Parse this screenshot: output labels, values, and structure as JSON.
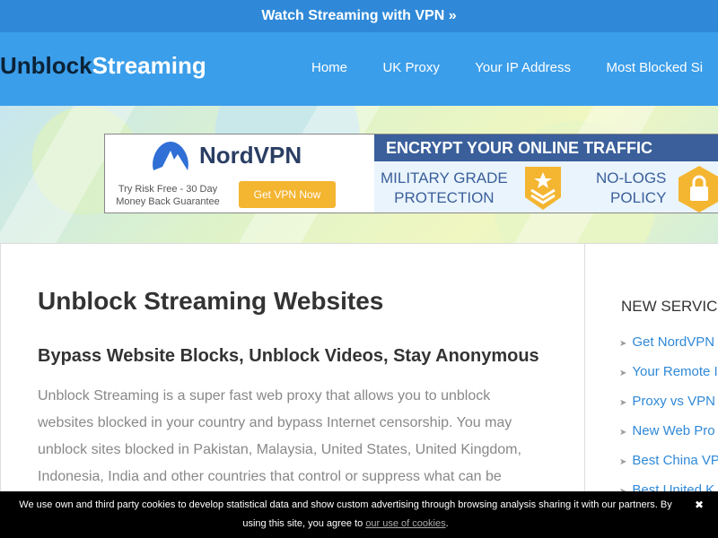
{
  "topbar": {
    "link": "Watch Streaming with VPN »"
  },
  "header": {
    "logo_part1": "Unblock",
    "logo_part2": "Streaming",
    "nav": [
      "Home",
      "UK Proxy",
      "Your IP Address",
      "Most Blocked Si"
    ]
  },
  "banner": {
    "brand": "NordVPN",
    "try_line1": "Try Risk Free - 30 Day",
    "try_line2": "Money Back Guarantee",
    "button": "Get VPN Now",
    "headline": "ENCRYPT YOUR ONLINE TRAFFIC",
    "feature1_line1": "MILITARY GRADE",
    "feature1_line2": "PROTECTION",
    "feature2_line1": "NO-LOGS",
    "feature2_line2": "POLICY"
  },
  "main": {
    "title": "Unblock Streaming Websites",
    "subtitle": "Bypass Website Blocks, Unblock Videos, Stay Anonymous",
    "intro": "Unblock Streaming is a super fast web proxy that allows you to unblock websites blocked in your country and bypass Internet censorship. You may unblock sites blocked in Pakistan, Malaysia, United States, United Kingdom, Indonesia, India and other countries that control or suppress what can be"
  },
  "sidebar": {
    "title": "NEW SERVIC",
    "items": [
      "Get NordVPN",
      "Your Remote I",
      "Proxy vs VPN",
      "New Web Pro",
      "Best China VP",
      "Best United K"
    ]
  },
  "cookie": {
    "text": "We use own and third party cookies to develop statistical data and show custom advertising through browsing analysis sharing it with our partners. By using this site, you agree to",
    "link": "our use of cookies",
    "close": "✖"
  },
  "colors": {
    "topbar": "#2f89d8",
    "header": "#3b9eea",
    "link": "#2f89d8",
    "nord_button": "#f4b531"
  }
}
